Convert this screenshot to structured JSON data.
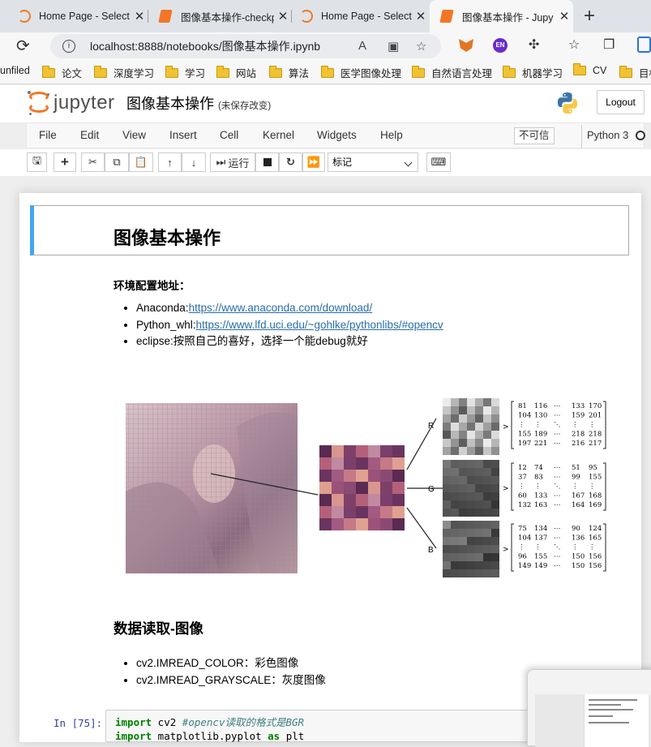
{
  "browser": {
    "tabs": [
      {
        "title": "Home Page - Select",
        "icon": "jupyter-icon",
        "active": false
      },
      {
        "title": "图像基本操作-checkp",
        "icon": "notebook-icon",
        "active": false
      },
      {
        "title": "Home Page - Select",
        "icon": "jupyter-icon",
        "active": false
      },
      {
        "title": "图像基本操作 - Jupy",
        "icon": "notebook-icon",
        "active": true
      }
    ],
    "close_glyph": "✕",
    "new_tab_glyph": "+",
    "url": "localhost:8888/notebooks/图像基本操作.ipynb",
    "extension_badge": "EN",
    "bookmarks": [
      "unfiled",
      "论文",
      "深度学习",
      "学习",
      "网站",
      "算法",
      "医学图像处理",
      "自然语言处理",
      "机器学习",
      "CV",
      "目标"
    ]
  },
  "jupyter": {
    "brand": "jupyter",
    "notebook_name": "图像基本操作",
    "save_status": "(未保存改变)",
    "logout_label": "Logout",
    "menu": [
      "File",
      "Edit",
      "View",
      "Insert",
      "Cell",
      "Kernel",
      "Widgets",
      "Help"
    ],
    "trusted_label": "不可信",
    "kernel_name": "Python 3",
    "toolbar": {
      "run_label": "运行",
      "cell_type": "标记"
    }
  },
  "notebook": {
    "title": "图像基本操作",
    "env_heading": "环境配置地址：",
    "env_items": [
      {
        "prefix": "Anaconda:",
        "link": "https://www.anaconda.com/download/"
      },
      {
        "prefix": "Python_whl:",
        "link": "https://www.lfd.uci.edu/~gohlke/pythonlibs/#opencv"
      },
      {
        "prefix": "eclipse:按照自己的喜好，选择一个能debug就好",
        "link": ""
      }
    ],
    "figure": {
      "channel_labels": [
        "R",
        "G",
        "B"
      ],
      "R_matrix": [
        [
          "81",
          "116",
          "⋯",
          "133",
          "170"
        ],
        [
          "104",
          "130",
          "⋯",
          "159",
          "201"
        ],
        [
          "⋮",
          "⋮",
          "⋱",
          "⋮",
          "⋮"
        ],
        [
          "155",
          "189",
          "⋯",
          "218",
          "218"
        ],
        [
          "197",
          "221",
          "⋯",
          "216",
          "217"
        ]
      ],
      "G_matrix": [
        [
          "12",
          "74",
          "⋯",
          "51",
          "95"
        ],
        [
          "37",
          "83",
          "⋯",
          "99",
          "155"
        ],
        [
          "⋮",
          "⋮",
          "⋱",
          "⋮",
          "⋮"
        ],
        [
          "60",
          "133",
          "⋯",
          "167",
          "168"
        ],
        [
          "132",
          "163",
          "⋯",
          "164",
          "169"
        ]
      ],
      "B_matrix": [
        [
          "75",
          "134",
          "⋯",
          "90",
          "124"
        ],
        [
          "104",
          "137",
          "⋯",
          "136",
          "165"
        ],
        [
          "⋮",
          "⋮",
          "⋱",
          "⋮",
          "⋮"
        ],
        [
          "96",
          "155",
          "⋯",
          "150",
          "156"
        ],
        [
          "149",
          "149",
          "⋯",
          "150",
          "156"
        ]
      ]
    },
    "section2_title": "数据读取-图像",
    "section2_items": [
      "cv2.IMREAD_COLOR：彩色图像",
      "cv2.IMREAD_GRAYSCALE：灰度图像"
    ],
    "code_prompt": "In  [75]:",
    "code_lines": [
      {
        "kw": "import",
        "rest": " cv2 ",
        "comment": "#opencv读取的格式是BGR"
      },
      {
        "kw": "import",
        "rest": " matplotlib.pyplot ",
        "kw2": "as",
        "rest2": " plt"
      }
    ]
  }
}
